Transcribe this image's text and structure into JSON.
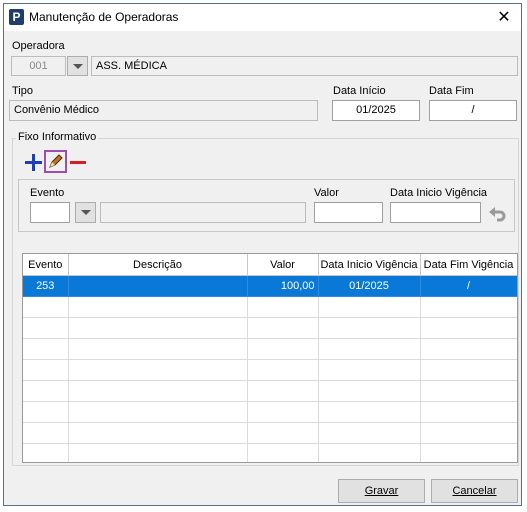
{
  "window": {
    "title": "Manutenção de Operadoras",
    "close_glyph": "✕",
    "app_icon_letter": "P"
  },
  "operadora": {
    "label": "Operadora",
    "code": "001",
    "name": "ASS. MÉDICA"
  },
  "tipo": {
    "label": "Tipo",
    "value": "Convênio Médico"
  },
  "data_inicio": {
    "label": "Data Início",
    "value": "01/2025"
  },
  "data_fim": {
    "label": "Data Fim",
    "value": "/"
  },
  "fixo": {
    "title": "Fixo Informativo",
    "toolbar": {
      "add_icon": "plus-icon",
      "edit_icon": "pencil-icon",
      "remove_icon": "minus-icon"
    },
    "evento_label": "Evento",
    "evento_value": "",
    "evento_desc": "",
    "valor_label": "Valor",
    "valor_value": "",
    "data_vig_label": "Data Inicio Vigência",
    "data_vig_value": "",
    "undo_icon": "undo-icon"
  },
  "grid": {
    "columns": [
      "Evento",
      "Descrição",
      "Valor",
      "Data Inicio Vigência",
      "Data Fim Vigência"
    ],
    "rows": [
      {
        "evento": "253",
        "descricao": "",
        "valor": "100,00",
        "inicio": "01/2025",
        "fim": "/"
      }
    ],
    "empty_rows": 8
  },
  "buttons": {
    "save": "Gravar",
    "cancel": "Cancelar"
  },
  "colors": {
    "selection": "#0a78d7",
    "add": "#1e3fb4",
    "remove": "#d81e1e",
    "edit_border": "#9b4fb0"
  }
}
